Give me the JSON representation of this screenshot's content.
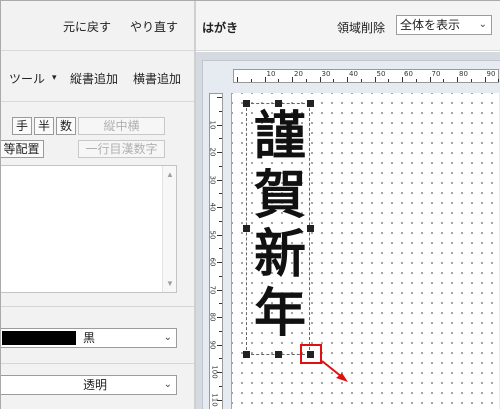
{
  "left": {
    "top_buttons": {
      "undo": "元に戻す",
      "redo": "やり直す"
    },
    "toolbar": {
      "tool_menu": "ツール",
      "tool_arrow": "▾",
      "add_vertical": "縦書追加",
      "add_horizontal": "横書追加"
    },
    "char_buttons": {
      "full_width": "手",
      "half_width": "半",
      "number": "数",
      "tate_chu_yoko": "縦中横"
    },
    "row2": {
      "equal_spacing": "等配置",
      "single_line_kanji_numerals": "一行目漢数字"
    },
    "color_select": {
      "value": "黒",
      "swatch": "#000000"
    },
    "bg_select": {
      "value": "透明"
    }
  },
  "right": {
    "title": "はがき",
    "area_delete_label": "領域削除",
    "view_select": {
      "value": "全体を表示"
    },
    "hruler_labels": [
      "10",
      "20",
      "30",
      "40",
      "50",
      "60",
      "70",
      "80",
      "90"
    ],
    "vruler_labels": [
      "10",
      "20",
      "30",
      "40",
      "50",
      "60",
      "70",
      "80",
      "90",
      "100",
      "110"
    ],
    "greeting": "謹賀新年"
  },
  "colors": {
    "highlight": "#e01010",
    "arrow": "#e01010",
    "panel_bg": "#f2f2f2",
    "canvas_bg": "#d5d9e0"
  }
}
